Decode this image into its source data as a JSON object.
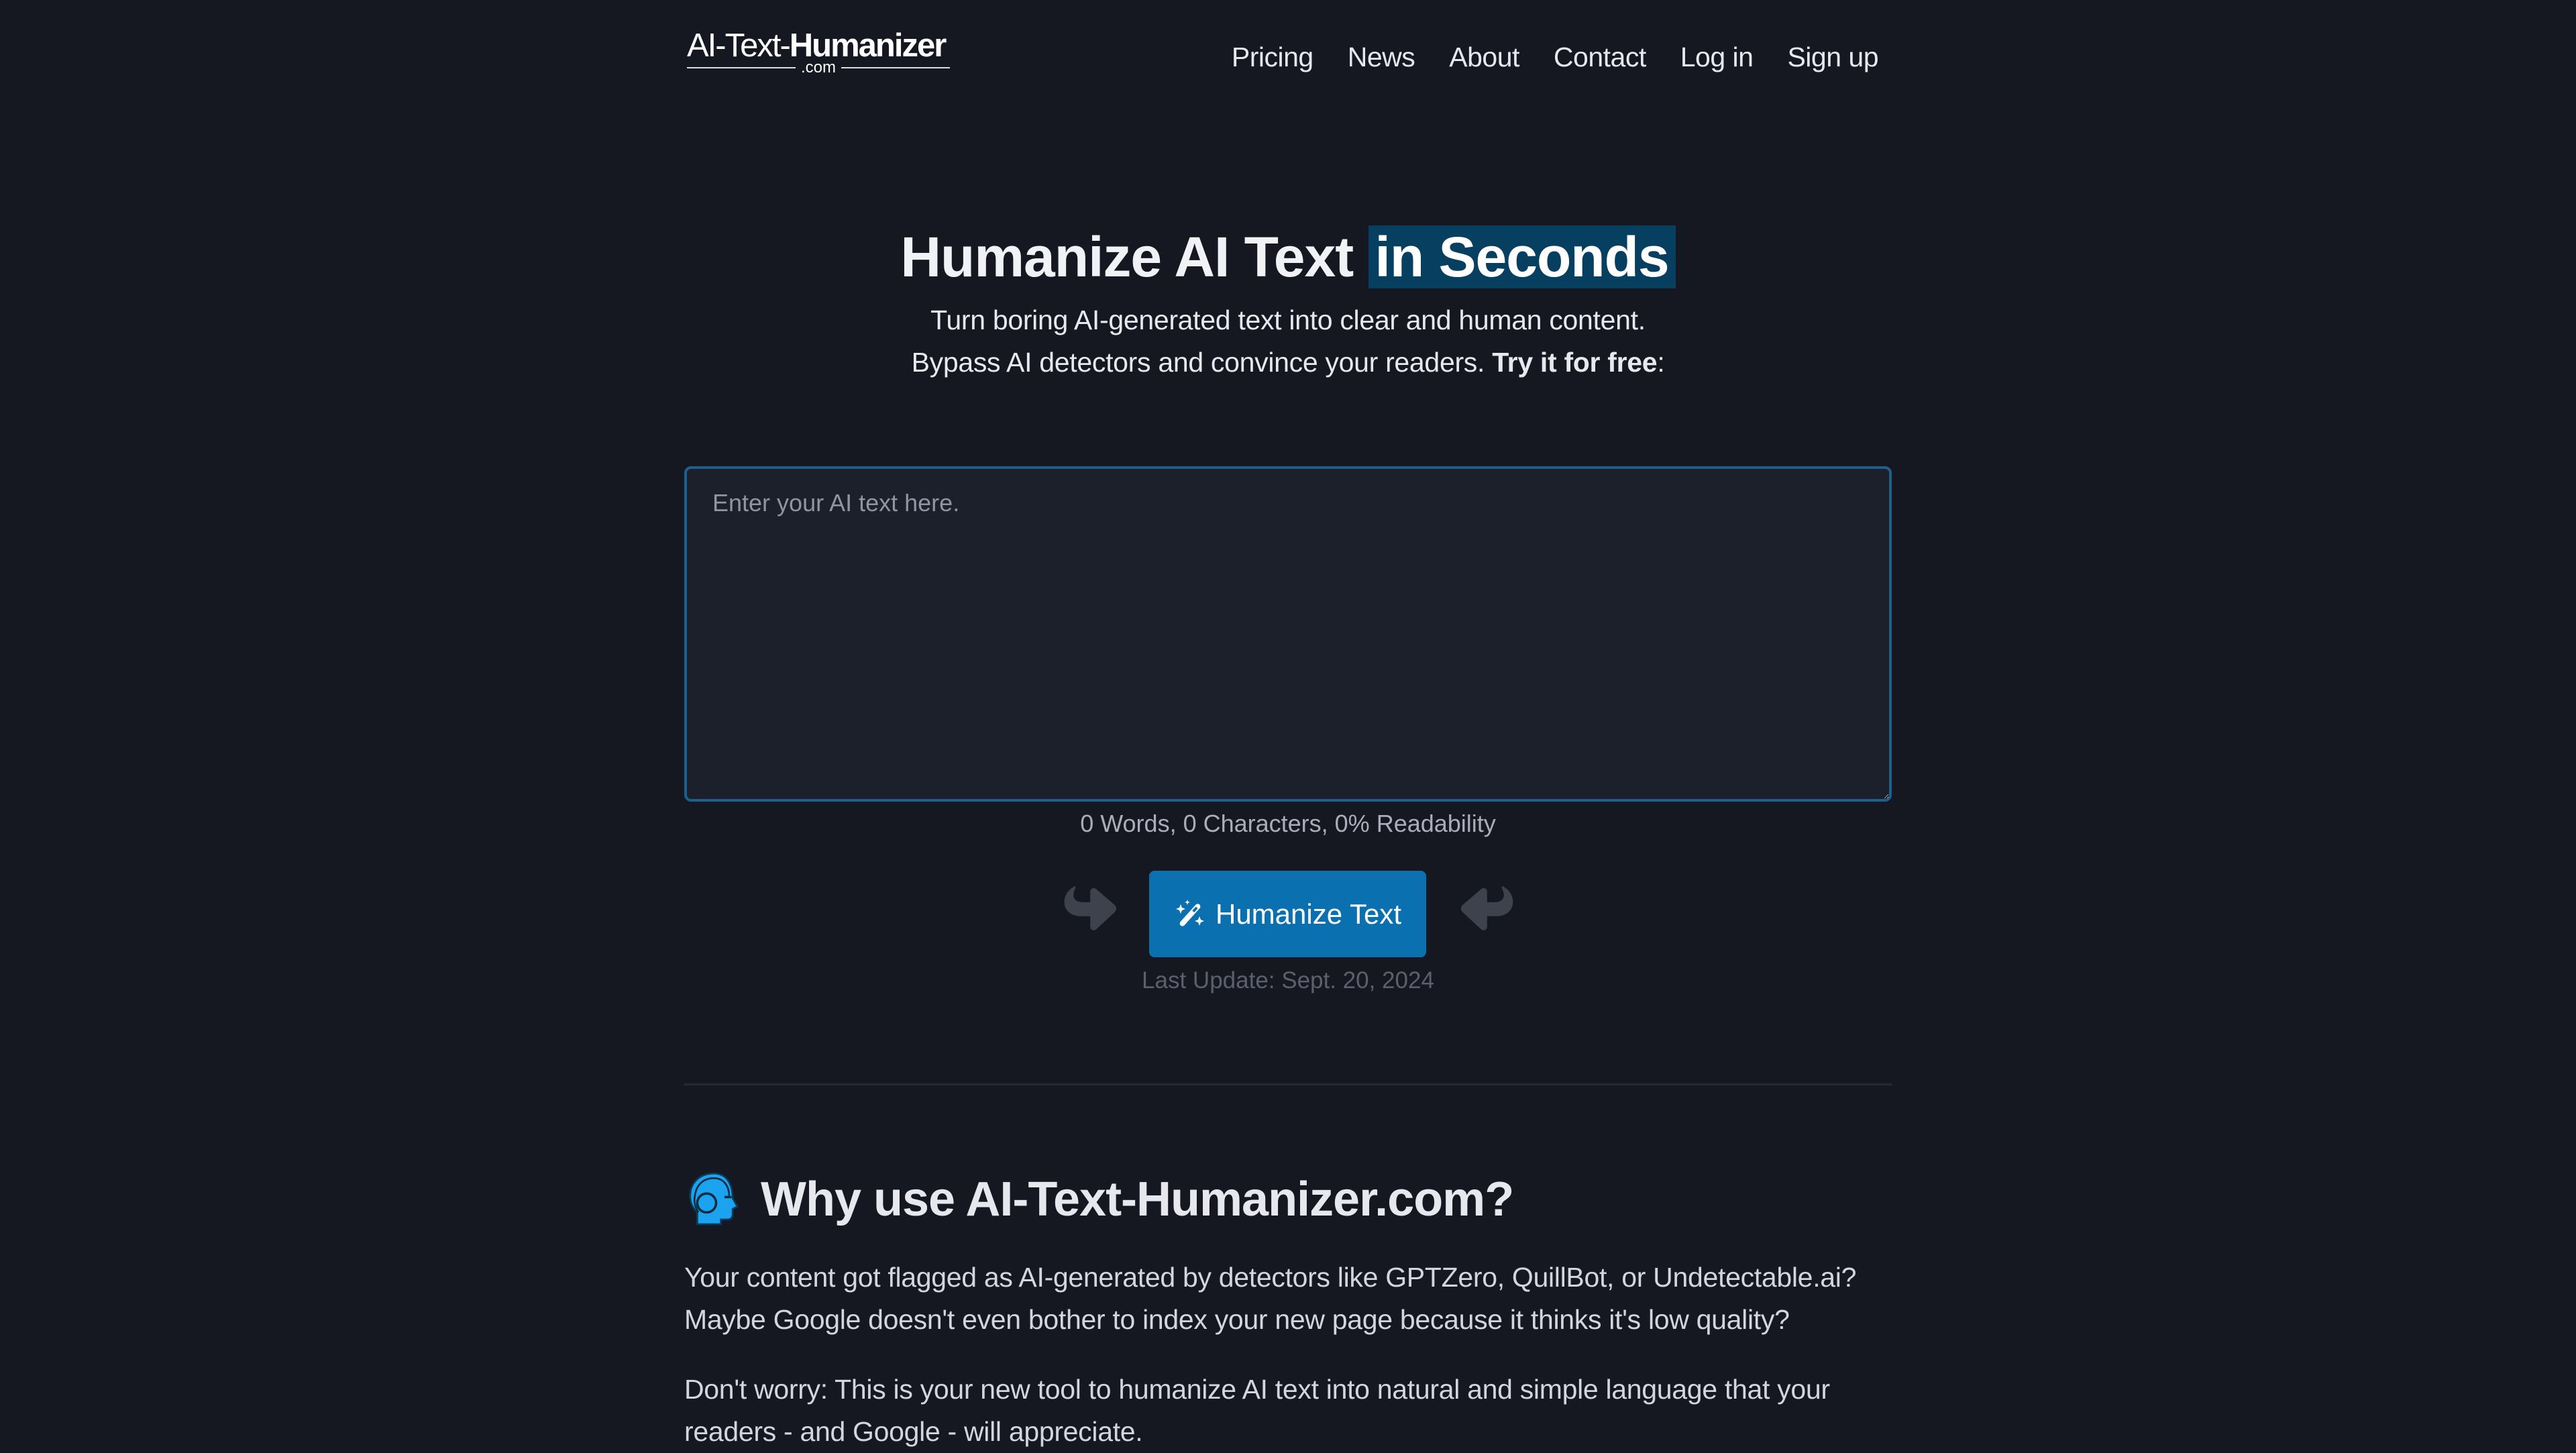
{
  "header": {
    "logo": {
      "part1": "AI-Text-",
      "part2": "Humanizer",
      "suffix": ".com"
    },
    "nav": [
      {
        "label": "Pricing"
      },
      {
        "label": "News"
      },
      {
        "label": "About"
      },
      {
        "label": "Contact"
      },
      {
        "label": "Log in"
      },
      {
        "label": "Sign up"
      }
    ]
  },
  "hero": {
    "title_plain": "Humanize AI Text ",
    "title_highlight": "in Seconds",
    "subtitle_line1": "Turn boring AI-generated text into clear and human content.",
    "subtitle_line2": "Bypass AI detectors and convince your readers. ",
    "subtitle_cta": "Try it for free",
    "subtitle_colon": ":"
  },
  "editor": {
    "value": "",
    "placeholder": "Enter your AI text here.",
    "stats": "0 Words, 0 Characters, 0% Readability"
  },
  "action": {
    "button_label": "Humanize Text",
    "button_icon": "magic-wand-icon",
    "left_icon": "curved-arrow-right-icon",
    "right_icon": "curved-arrow-left-icon",
    "last_update": "Last Update: Sept. 20, 2024"
  },
  "why": {
    "icon": "human-head-icon",
    "title": "Why use AI-Text-Humanizer.com?",
    "paragraph1": "Your content got flagged as AI-generated by detectors like GPTZero, QuillBot, or Undetectable.ai? Maybe Google doesn't even bother to index your new page because it thinks it's low quality?",
    "paragraph2": "Don't worry: This is your new tool to humanize AI text into natural and simple language that your readers - and Google - will appreciate."
  },
  "colors": {
    "background": "#151821",
    "accent": "#0b70b0",
    "highlight": "#073f61",
    "textarea_border": "#1d5f8d",
    "icon_blue": "#1ba3ef"
  }
}
